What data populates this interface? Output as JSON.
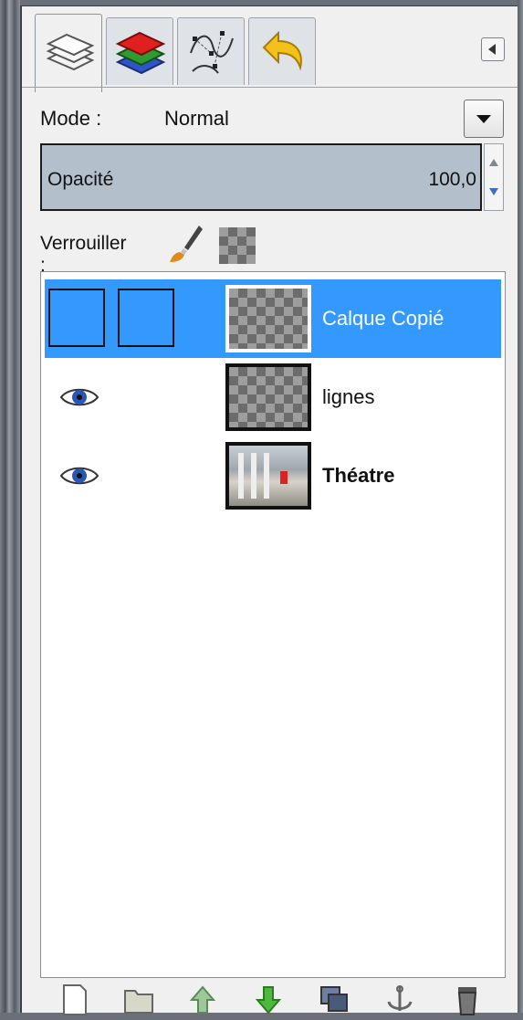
{
  "tabs": [
    {
      "name": "layers",
      "icon": "layers-icon",
      "active": true
    },
    {
      "name": "channels",
      "icon": "channels-icon",
      "active": false
    },
    {
      "name": "paths",
      "icon": "paths-icon",
      "active": false
    },
    {
      "name": "undo-history",
      "icon": "undo-icon",
      "active": false
    }
  ],
  "mode": {
    "label": "Mode :",
    "value": "Normal"
  },
  "opacity": {
    "label": "Opacité",
    "value": "100,0"
  },
  "lock": {
    "label": "Verrouiller :"
  },
  "layers": [
    {
      "name": "Calque Copié",
      "selected": true,
      "visible": false,
      "bold": false
    },
    {
      "name": "lignes",
      "selected": false,
      "visible": true,
      "bold": false
    },
    {
      "name": "Théatre",
      "selected": false,
      "visible": true,
      "bold": true
    }
  ],
  "bottom_buttons": [
    "new-layer-icon",
    "new-group-icon",
    "raise-layer-icon",
    "lower-layer-icon",
    "duplicate-layer-icon",
    "anchor-layer-icon",
    "delete-layer-icon"
  ],
  "colors": {
    "selection": "#3399ff",
    "opacity_bg": "#b3c0cc",
    "panel_bg": "#f0f0f0"
  }
}
